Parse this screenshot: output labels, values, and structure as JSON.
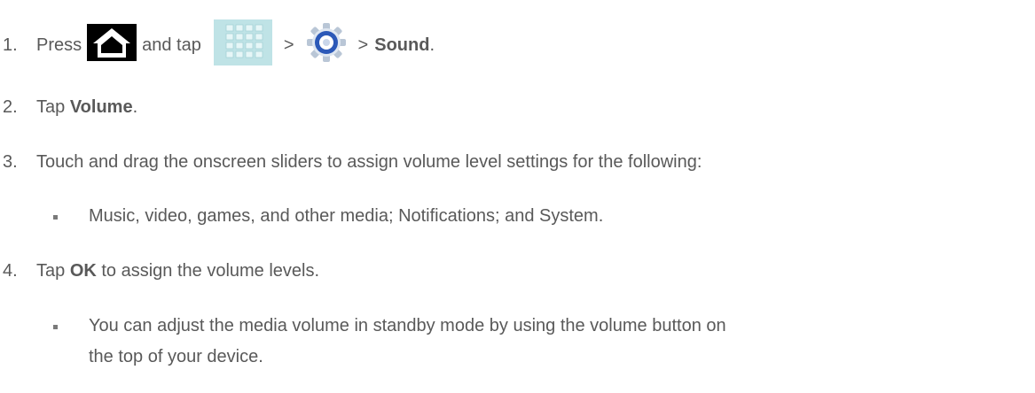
{
  "steps": [
    {
      "number": "1.",
      "parts": {
        "press": "Press",
        "and_tap": "and tap",
        "sep1": ">",
        "sep2": ">",
        "target": "Sound",
        "end": "."
      },
      "icons": [
        "home-key-icon",
        "apps-grid-icon",
        "settings-gear-icon"
      ]
    },
    {
      "number": "2.",
      "pre": "Tap",
      "bold": "Volume",
      "post": "."
    },
    {
      "number": "3.",
      "text": "Touch and drag the onscreen sliders to assign volume level settings for the following:"
    },
    {
      "number": "4.",
      "pre": "Tap",
      "bold": "OK",
      "post": " to assign the volume levels."
    }
  ],
  "bullets": {
    "step3": "Music, video, games, and other media; Notifications; and System.",
    "step4_line1": "You can adjust the media volume in standby mode by using the volume button on",
    "step4_line2": "the top of your device."
  },
  "colors": {
    "text": "#595959",
    "home_icon_bg": "#000000",
    "grid_icon_bg": "#bfe3e6",
    "gear_ring": "#2c59b8"
  }
}
